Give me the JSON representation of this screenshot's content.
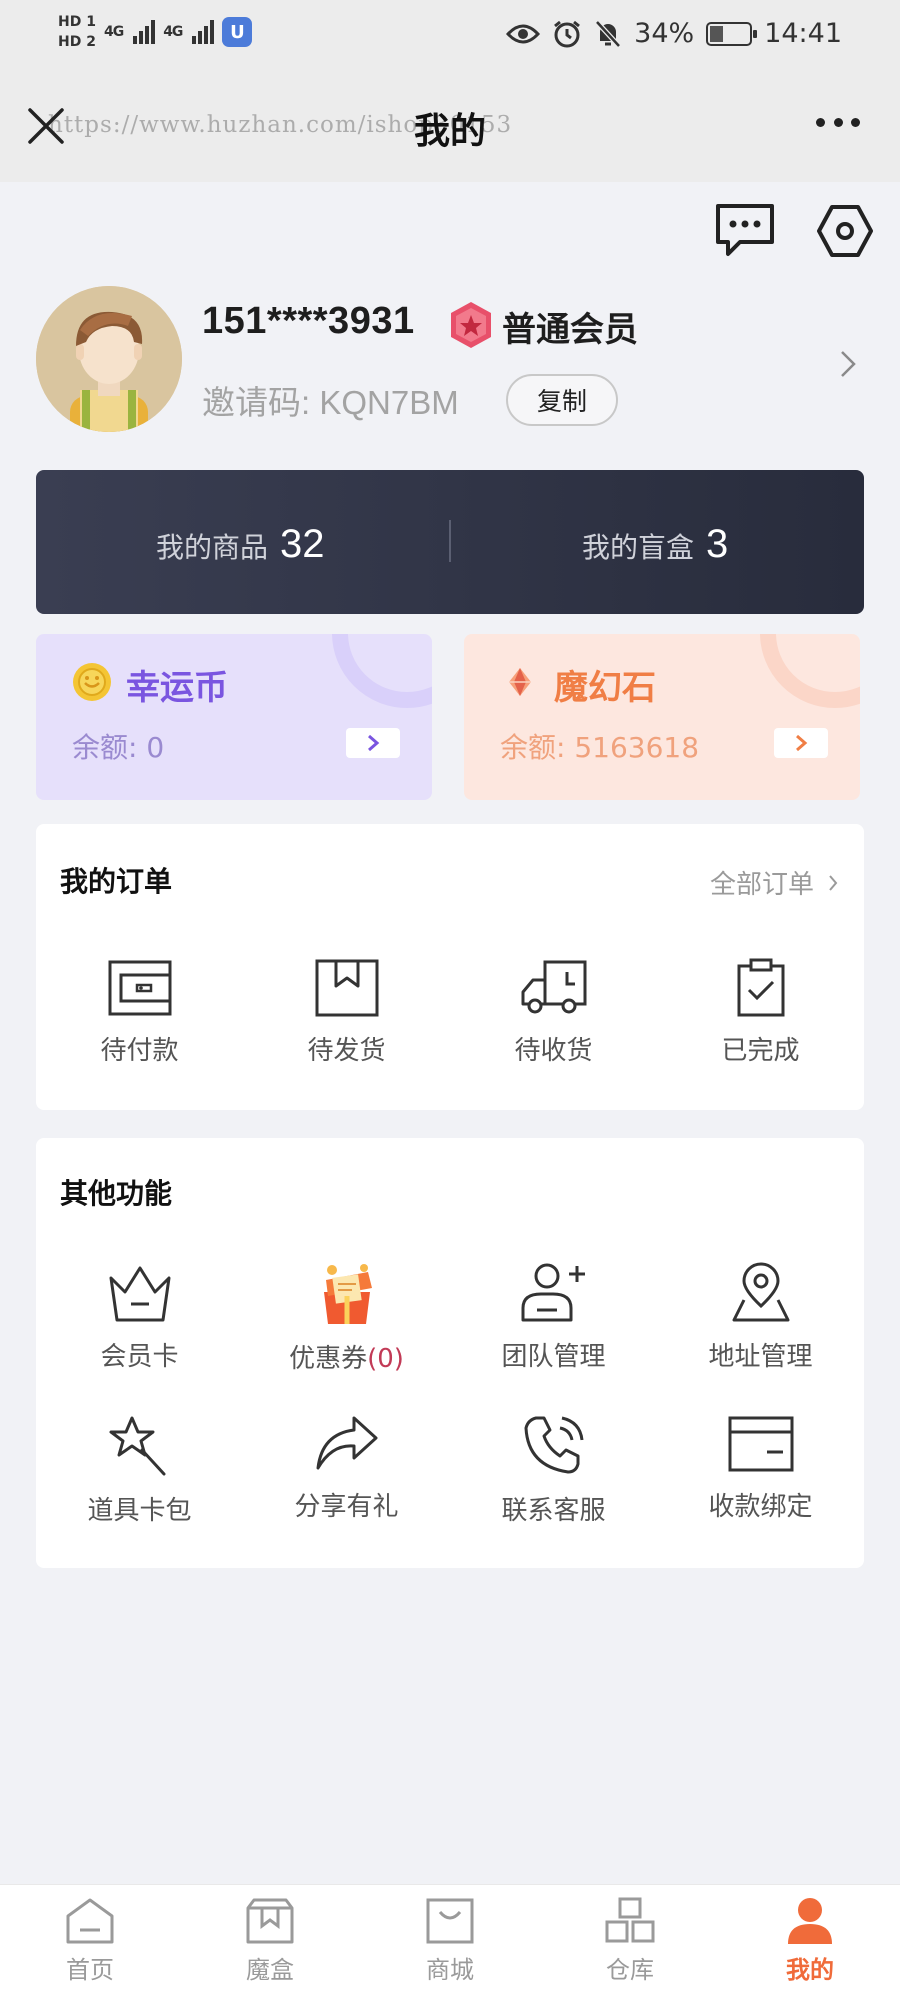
{
  "status_bar": {
    "hd1": "HD 1",
    "hd2": "HD 2",
    "net1": "4G",
    "net2": "4G",
    "app_badge": "U",
    "battery": "34%",
    "battery_level": 0.34,
    "time": "14:41",
    "icons": [
      "eye-icon",
      "alarm-icon",
      "mute-bell-icon",
      "battery-icon"
    ]
  },
  "header": {
    "title": "我的",
    "watermark": "https://www.huzhan.com/ishop30153",
    "close_icon": "close-icon",
    "more_icon": "more-icon"
  },
  "profile": {
    "phone": "151****3931",
    "member_level": "普通会员",
    "invite_code": "邀请码: KQN7BM",
    "copy_label": "复制"
  },
  "stats": {
    "goods_label": "我的商品",
    "goods_count": "32",
    "boxes_label": "我的盲盒",
    "boxes_count": "3"
  },
  "wallet": {
    "lucky": {
      "title": "幸运币",
      "balance": "余额: 0"
    },
    "magic": {
      "title": "魔幻石",
      "balance": "余额: 5163618"
    }
  },
  "orders": {
    "title": "我的订单",
    "all_label": "全部订单",
    "items": [
      {
        "label": "待付款",
        "icon": "wallet-icon"
      },
      {
        "label": "待发货",
        "icon": "package-icon"
      },
      {
        "label": "待收货",
        "icon": "delivery-truck-icon"
      },
      {
        "label": "已完成",
        "icon": "clipboard-check-icon"
      }
    ]
  },
  "other": {
    "title": "其他功能",
    "items": [
      {
        "label": "会员卡",
        "icon": "crown-icon"
      },
      {
        "label": "优惠券",
        "count": "(0)",
        "icon": "coupon-gift-icon"
      },
      {
        "label": "团队管理",
        "icon": "add-user-icon"
      },
      {
        "label": "地址管理",
        "icon": "map-pin-icon"
      },
      {
        "label": "道具卡包",
        "icon": "magic-wand-icon"
      },
      {
        "label": "分享有礼",
        "icon": "share-icon"
      },
      {
        "label": "联系客服",
        "icon": "phone-icon"
      },
      {
        "label": "收款绑定",
        "icon": "card-icon"
      }
    ]
  },
  "tabbar": {
    "items": [
      {
        "label": "首页",
        "icon": "home-icon"
      },
      {
        "label": "魔盒",
        "icon": "box-icon"
      },
      {
        "label": "商城",
        "icon": "shop-bag-icon"
      },
      {
        "label": "仓库",
        "icon": "warehouse-icon"
      },
      {
        "label": "我的",
        "icon": "profile-icon",
        "active": true
      }
    ]
  },
  "colors": {
    "accent": "#f06b3a",
    "lucky": "#7a55e0",
    "magic": "#f07e45",
    "stats_bg": "#2f3344"
  }
}
